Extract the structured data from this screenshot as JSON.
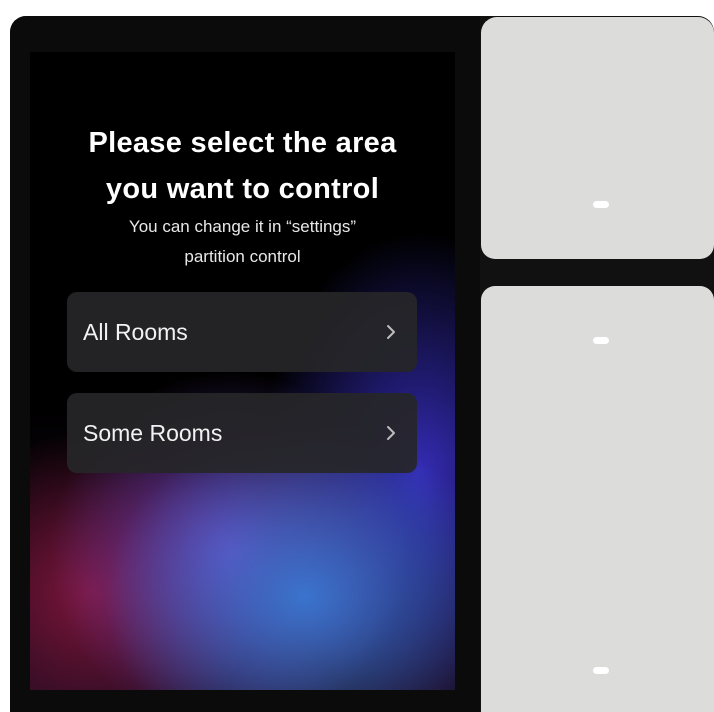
{
  "screen": {
    "title_line1": "Please select the area",
    "title_line2": "you want to control",
    "subtitle_line1": "You can change it in “settings”",
    "subtitle_line2": "partition control",
    "options": [
      {
        "label": "All Rooms",
        "icon": "chevron-right-icon"
      },
      {
        "label": "Some Rooms",
        "icon": "chevron-right-icon"
      }
    ]
  },
  "switch_panels": [
    {
      "name": "top-switch-panel",
      "indicators": 1
    },
    {
      "name": "bottom-switch-panel",
      "indicators": 2
    }
  ],
  "colors": {
    "panel": "#dcdcda",
    "option_card": "#262628",
    "indicator": "#ffffff"
  }
}
